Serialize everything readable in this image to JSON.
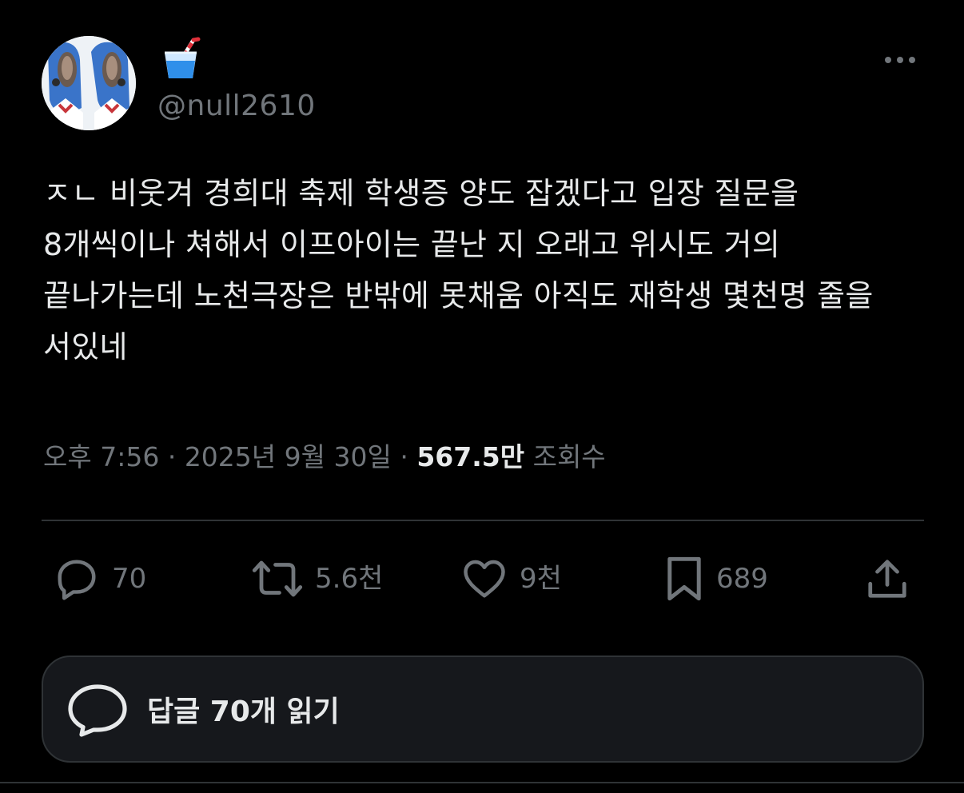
{
  "author": {
    "display_name_icon": "cup-with-straw-emoji",
    "handle": "@null2610",
    "avatar": "avatar"
  },
  "tweet": {
    "text": "ㅈㄴ 비웃겨 경희대 축제 학생증 양도 잡겠다고 입장 질문을 8개씩이나 쳐해서 이프아이는 끝난 지 오래고 위시도 거의 끝나가는데 노천극장은 반밖에 못채움 아직도 재학생 몇천명 줄을 서있네"
  },
  "meta": {
    "time": "오후 7:56",
    "separator": " · ",
    "date": "2025년 9월 30일",
    "views_count": "567.5만",
    "views_label": "조회수"
  },
  "actions": {
    "replies": "70",
    "retweets": "5.6천",
    "likes": "9천",
    "bookmarks": "689"
  },
  "read_replies": {
    "label": "답글 70개 읽기"
  },
  "colors": {
    "background": "#000000",
    "text": "#e7e9ea",
    "secondary": "#71767b",
    "border": "#2f3336"
  }
}
